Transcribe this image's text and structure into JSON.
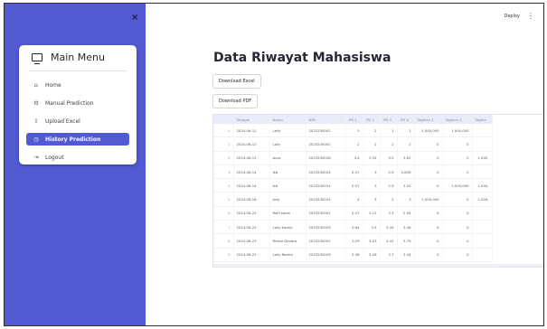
{
  "sidebar": {
    "close_glyph": "×",
    "menu_title": "Main Menu",
    "items": [
      {
        "label": "Home",
        "icon": "house-icon",
        "glyph": "⌂"
      },
      {
        "label": "Manual Prediction",
        "icon": "gear-icon",
        "glyph": "⚙"
      },
      {
        "label": "Upload Excel",
        "icon": "upload-icon",
        "glyph": "⇧"
      },
      {
        "label": "History Prediction",
        "icon": "clock-icon",
        "glyph": "◷",
        "active": true
      },
      {
        "label": "Logout",
        "icon": "logout-icon",
        "glyph": "⇥"
      }
    ]
  },
  "topbar": {
    "deploy_label": "Deploy",
    "menu_glyph": "⋮"
  },
  "page": {
    "title": "Data Riwayat Mahasiswa",
    "download_excel_label": "Download Excel",
    "download_pdf_label": "Download PDF"
  },
  "table": {
    "columns": [
      "",
      "Tanggal",
      "Nama",
      "NIM",
      "IPS 1",
      "IPS 2",
      "IPS 3",
      "IPS 4",
      "Tagihan 1",
      "Tagihan 2",
      "Tagiha"
    ],
    "rows": [
      [
        "0",
        "2024-06-12",
        "Laily",
        "2023230002",
        "3",
        "2",
        "1",
        "1",
        "1,000,000",
        "1,000,000",
        ""
      ],
      [
        "1",
        "2024-06-12",
        "Laily",
        "2023230002",
        "2",
        "2",
        "2",
        "2",
        "0",
        "0",
        ""
      ],
      [
        "2",
        "2024-06-13",
        "Aura",
        "2023230028",
        "3.4",
        "3.35",
        "3.5",
        "3.63",
        "0",
        "0",
        "1,000,"
      ],
      [
        "3",
        "2024-06-14",
        "Ikti",
        "2023230024",
        "2.57",
        "3",
        "2.9",
        "0.835",
        "0",
        "0",
        ""
      ],
      [
        "4",
        "2024-06-14",
        "ikti",
        "2023230024",
        "2.57",
        "3",
        "2.9",
        "3.25",
        "0",
        "1,000,000",
        "1,000,"
      ],
      [
        "5",
        "2024-06-18",
        "laily",
        "2023230024",
        "4",
        "3",
        "2",
        "3",
        "1,000,000",
        "0",
        "1,000,"
      ],
      [
        "6",
        "2024-06-23",
        "Rofil kamil",
        "2023230002",
        "2.57",
        "3.12",
        "3.3",
        "2.94",
        "0",
        "0",
        ""
      ],
      [
        "7",
        "2024-06-23",
        "Laily Kadriz",
        "2023230029",
        "3.64",
        "3.5",
        "3.49",
        "3.46",
        "0",
        "0",
        ""
      ],
      [
        "8",
        "2024-06-23",
        "Rhesa Devara",
        "2023230002",
        "3.29",
        "3.23",
        "3.43",
        "3.79",
        "0",
        "0",
        ""
      ],
      [
        "9",
        "2024-06-23",
        "Laily Badria",
        "2023230029",
        "3.38",
        "3.28",
        "3.7",
        "3.44",
        "0",
        "0",
        ""
      ]
    ]
  }
}
